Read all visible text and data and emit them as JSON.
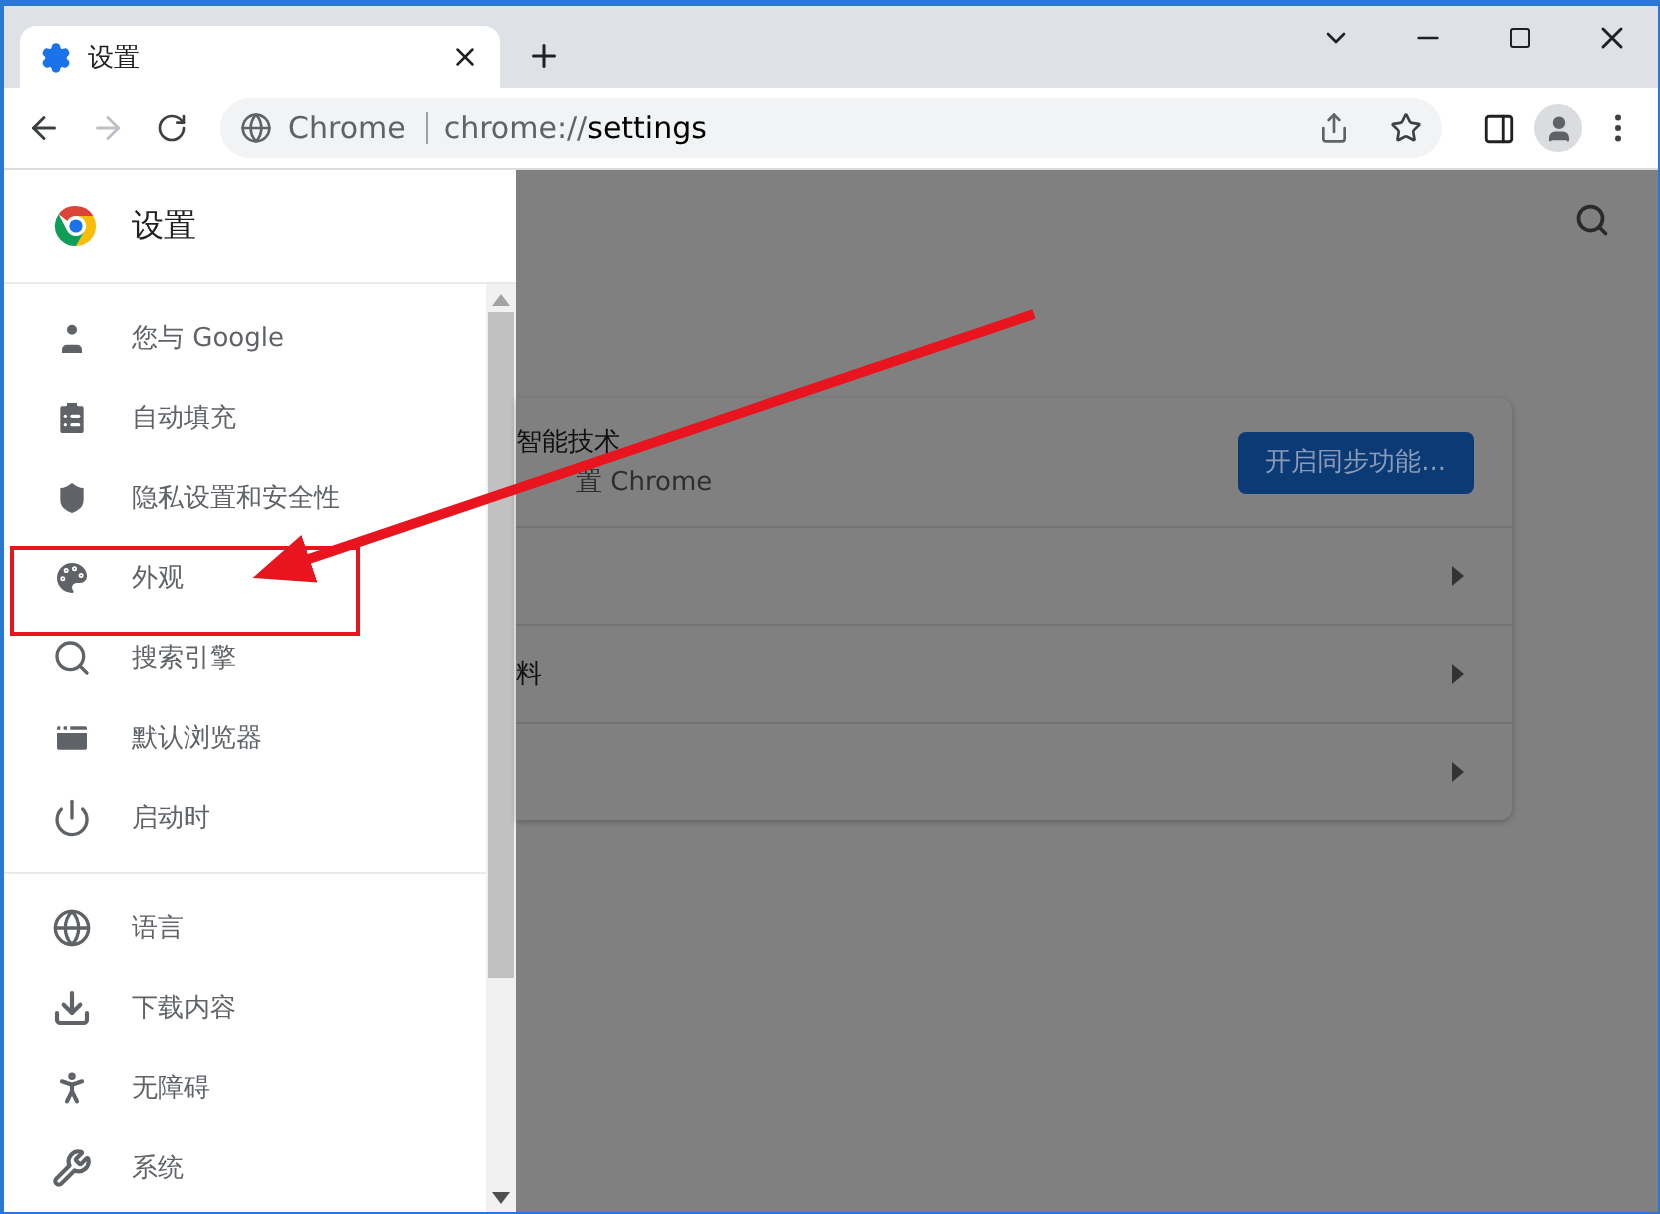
{
  "tabs": [
    {
      "title": "设置",
      "selected": true
    }
  ],
  "address_bar": {
    "site_label": "Chrome",
    "url_prefix": "chrome://",
    "url_path": "settings"
  },
  "sidebar": {
    "title": "设置",
    "sections": [
      {
        "items": [
          {
            "label": "您与 Google"
          },
          {
            "label": "自动填充"
          },
          {
            "label": "隐私设置和安全性"
          },
          {
            "label": "外观"
          },
          {
            "label": "搜索引擎"
          },
          {
            "label": "默认浏览器"
          },
          {
            "label": "启动时"
          }
        ]
      },
      {
        "items": [
          {
            "label": "语言"
          },
          {
            "label": "下载内容"
          },
          {
            "label": "无障碍"
          },
          {
            "label": "系统"
          }
        ]
      }
    ]
  },
  "main": {
    "sync_card": {
      "title": "智能技术",
      "subtitle": "置 Chrome",
      "button": "开启同步功能..."
    },
    "rows": [
      {
        "kind": "link"
      },
      {
        "kind": "link",
        "label": "料"
      },
      {
        "kind": "link"
      }
    ]
  }
}
